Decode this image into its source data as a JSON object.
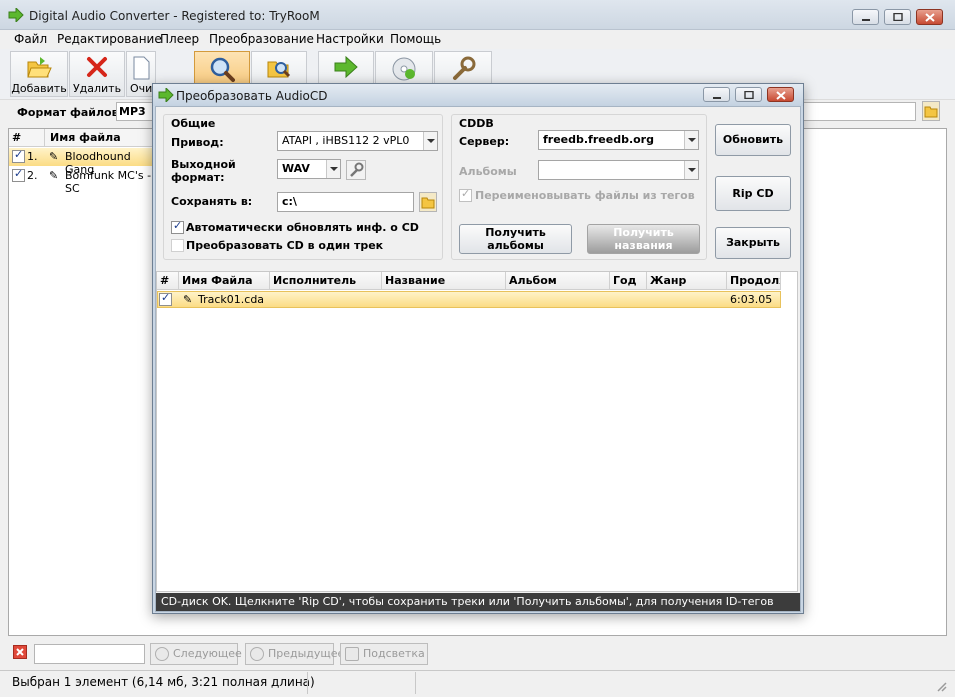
{
  "window": {
    "title": "Digital Audio Converter - Registered to: TryRooM"
  },
  "menu": [
    "Файл",
    "Редактирование",
    "Плеер",
    "Преобразование",
    "Настройки",
    "Помощь"
  ],
  "toolbar": {
    "add_label": "Добавить",
    "remove_label": "Удалить",
    "clear_label": "Очи"
  },
  "format": {
    "label": "Формат файлов:",
    "value": "MP3"
  },
  "main_list": {
    "col_num": "#",
    "col_name": "Имя файла",
    "rows": [
      {
        "num": "1.",
        "name": "Bloodhound Gang"
      },
      {
        "num": "2.",
        "name": "Bomfunk MC's - SC"
      }
    ]
  },
  "bottom": {
    "next_label": "Следующее",
    "prev_label": "Предыдущее",
    "highlight_label": "Подсветка"
  },
  "status": {
    "text": "Выбран 1 элемент (6,14 мб, 3:21 полная длина)"
  },
  "dialog": {
    "title": "Преобразовать AudioCD",
    "general": {
      "heading": "Общие",
      "drive_label": "Привод:",
      "drive_value": "ATAPI   , iHBS112  2    vPL0",
      "output_label_1": "Выходной",
      "output_label_2": "формат:",
      "output_value": "WAV",
      "save_label": "Сохранять в:",
      "save_value": "c:\\",
      "auto_update_label": "Автоматически обновлять инф. о CD",
      "auto_update_checked": true,
      "single_track_label": "Преобразовать CD в один трек",
      "single_track_checked": false
    },
    "cddb": {
      "heading": "CDDB",
      "server_label": "Сервер:",
      "server_value": "freedb.freedb.org",
      "albums_label": "Альбомы",
      "albums_value": "",
      "rename_label": "Переименовывать файлы из тегов",
      "rename_checked": true,
      "get_albums_label_1": "Получить",
      "get_albums_label_2": "альбомы",
      "get_names_label_1": "Получить",
      "get_names_label_2": "названия"
    },
    "buttons": {
      "refresh": "Обновить",
      "rip": "Rip CD",
      "close": "Закрыть"
    },
    "grid": {
      "columns": [
        "#",
        "Имя Файла",
        "Исполнитель",
        "Название",
        "Альбом",
        "Год",
        "Жанр",
        "Продолж"
      ],
      "rows": [
        {
          "checked": true,
          "file": "Track01.cda",
          "artist": "",
          "title": "",
          "album": "",
          "year": "",
          "genre": "",
          "duration": "6:03.05"
        }
      ]
    },
    "status": "CD-диск OK. Щелкните 'Rip CD', чтобы сохранить треки или 'Получить альбомы', для получения ID-тегов"
  },
  "colors": {
    "selection": "#fbdc85",
    "dialog_status_bg": "#3c3c3c",
    "toolbar_active": "#f6c26e"
  }
}
